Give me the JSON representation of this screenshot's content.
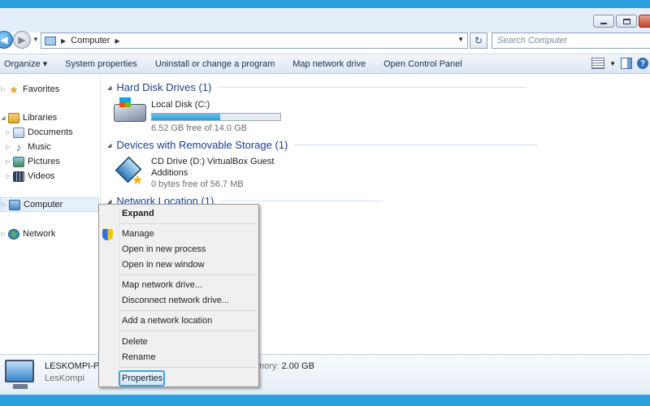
{
  "window": {
    "accent": "#2aa0dc"
  },
  "address_bar": {
    "path": "Computer",
    "search_placeholder": "Search Computer"
  },
  "toolbar": {
    "items": [
      "Organize ▾",
      "System properties",
      "Uninstall or change a program",
      "Map network drive",
      "Open Control Panel"
    ]
  },
  "nav_pane": {
    "favorites": "Favorites",
    "libraries": "Libraries",
    "documents": "Documents",
    "music": "Music",
    "pictures": "Pictures",
    "videos": "Videos",
    "computer": "Computer",
    "network": "Network"
  },
  "content": {
    "groups": [
      {
        "title": "Hard Disk Drives (1)"
      },
      {
        "title": "Devices with Removable Storage (1)"
      },
      {
        "title": "Network Location (1)"
      }
    ],
    "local_disk": {
      "name": "Local Disk (C:)",
      "free": "6.52 GB free of 14.0 GB",
      "used_fraction": 0.534
    },
    "cd_drive": {
      "name_line1": "CD Drive (D:) VirtualBox Guest",
      "name_line2": "Additions",
      "free": "0 bytes free of 56.7 MB"
    }
  },
  "details": {
    "name": "LESKOMPI-PC",
    "workgroup": "LesKompi",
    "memory_label": "mory:",
    "memory_value": "2.00 GB"
  },
  "context_menu": {
    "expand": "Expand",
    "manage": "Manage",
    "open_new_process": "Open in new process",
    "open_new_window": "Open in new window",
    "map_network_drive": "Map network drive...",
    "disconnect_network_drive": "Disconnect network drive...",
    "add_network_location": "Add a network location",
    "delete": "Delete",
    "rename": "Rename",
    "properties": "Properties"
  }
}
